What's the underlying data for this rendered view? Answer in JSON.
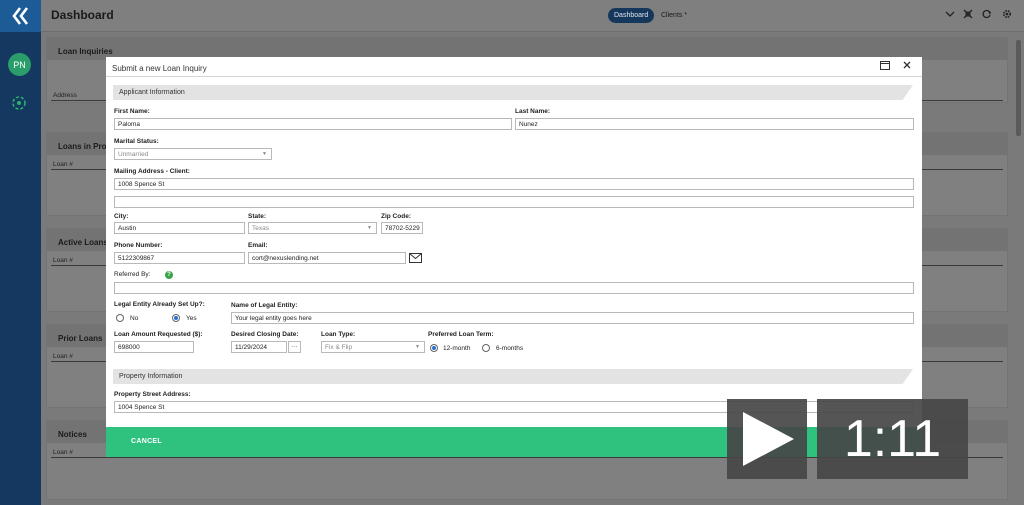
{
  "app": {
    "title": "Dashboard",
    "active_tab": "Dashboard",
    "tab_clients": "Clients *",
    "user_initials": "PN"
  },
  "cards": [
    {
      "title": "Loan Inquiries",
      "column": "Address"
    },
    {
      "title": "Loans in Pro",
      "column": "Loan #"
    },
    {
      "title": "Active Loans",
      "column": "Loan #"
    },
    {
      "title": "Prior Loans",
      "column": "Loan #"
    },
    {
      "title": "Notices",
      "column": "Loan #"
    }
  ],
  "modal": {
    "title": "Submit a new Loan Inquiry",
    "section_applicant": "Applicant Information",
    "section_property": "Property Information",
    "first_name_label": "First Name:",
    "first_name": "Paloma",
    "last_name_label": "Last Name:",
    "last_name": "Nunez",
    "marital_label": "Marital Status:",
    "marital": "Unmarried",
    "mailing_label": "Mailing Address - Client:",
    "mailing_1": "1008 Spence St",
    "mailing_2": "",
    "city_label": "City:",
    "city": "Austin",
    "state_label": "State:",
    "state": "Texas",
    "zip_label": "Zip Code:",
    "zip": "78702-5229",
    "phone_label": "Phone Number:",
    "phone": "5122309867",
    "email_label": "Email:",
    "email": "cort@nexuslending.net",
    "referred_label": "Referred By:",
    "referred": "",
    "entity_setup_label": "Legal Entity Already Set Up?:",
    "entity_no": "No",
    "entity_yes": "Yes",
    "entity_name_label": "Name of Legal Entity:",
    "entity_name": "Your legal entity goes here",
    "amount_label": "Loan Amount Requested ($):",
    "amount": "698000",
    "closing_label": "Desired Closing Date:",
    "closing": "11/29/2024",
    "loan_type_label": "Loan Type:",
    "loan_type": "Fix & Flip",
    "term_label": "Preferred Loan Term:",
    "term_12": "12-month",
    "term_6": "6-months",
    "property_address_label": "Property Street Address:",
    "property_address": "1004 Spence St",
    "cancel": "CANCEL"
  },
  "video": {
    "time": "1:11"
  }
}
